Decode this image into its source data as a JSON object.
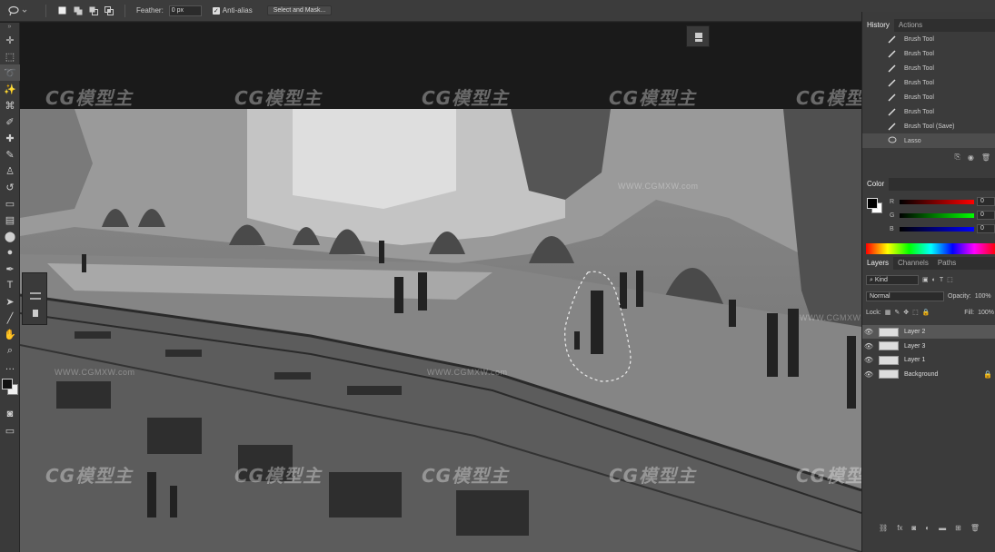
{
  "options_bar": {
    "feather_label": "Feather:",
    "feather_value": "0 px",
    "antialias_label": "Anti-alias",
    "select_mask_label": "Select and Mask..."
  },
  "toolbar": {
    "header": "»",
    "tools": [
      {
        "name": "move-tool-icon",
        "glyph": "✛"
      },
      {
        "name": "marquee-tool-icon",
        "glyph": "⬚"
      },
      {
        "name": "lasso-tool-icon",
        "glyph": "➰"
      },
      {
        "name": "magic-wand-tool-icon",
        "glyph": "✨"
      },
      {
        "name": "crop-tool-icon",
        "glyph": "⌘"
      },
      {
        "name": "eyedropper-tool-icon",
        "glyph": "✐"
      },
      {
        "name": "healing-brush-tool-icon",
        "glyph": "✚"
      },
      {
        "name": "brush-tool-icon",
        "glyph": "✎"
      },
      {
        "name": "clone-stamp-tool-icon",
        "glyph": "♙"
      },
      {
        "name": "history-brush-tool-icon",
        "glyph": "↺"
      },
      {
        "name": "eraser-tool-icon",
        "glyph": "▭"
      },
      {
        "name": "gradient-tool-icon",
        "glyph": "▤"
      },
      {
        "name": "blur-tool-icon",
        "glyph": "⬤"
      },
      {
        "name": "dodge-tool-icon",
        "glyph": "●"
      },
      {
        "name": "pen-tool-icon",
        "glyph": "✒"
      },
      {
        "name": "type-tool-icon",
        "glyph": "T"
      },
      {
        "name": "path-selection-tool-icon",
        "glyph": "➤"
      },
      {
        "name": "line-tool-icon",
        "glyph": "╱"
      },
      {
        "name": "hand-tool-icon",
        "glyph": "✋"
      },
      {
        "name": "zoom-tool-icon",
        "glyph": "⌕"
      },
      {
        "name": "more-tools-icon",
        "glyph": "…"
      }
    ]
  },
  "watermark": {
    "brand": "CG模型主",
    "url": "WWW.CGMXW.com"
  },
  "history_panel": {
    "tabs": [
      "History",
      "Actions"
    ],
    "items": [
      "Brush Tool",
      "Brush Tool",
      "Brush Tool",
      "Brush Tool",
      "Brush Tool",
      "Brush Tool",
      "Brush Tool (Save)",
      "Lasso"
    ],
    "selected_index": 7
  },
  "color_panel": {
    "title": "Color",
    "channels": [
      {
        "label": "R",
        "value": "0"
      },
      {
        "label": "G",
        "value": "0"
      },
      {
        "label": "B",
        "value": "0"
      }
    ]
  },
  "layers_panel": {
    "tabs": [
      "Layers",
      "Channels",
      "Paths"
    ],
    "kind_label": "Kind",
    "blend_mode": "Normal",
    "opacity_label": "Opacity:",
    "opacity_value": "100%",
    "lock_label": "Lock:",
    "fill_label": "Fill:",
    "fill_value": "100%",
    "layers": [
      {
        "name": "Layer 2",
        "selected": true
      },
      {
        "name": "Layer 3",
        "selected": false
      },
      {
        "name": "Layer 1",
        "selected": false
      },
      {
        "name": "Background",
        "selected": false,
        "locked": true
      }
    ]
  }
}
